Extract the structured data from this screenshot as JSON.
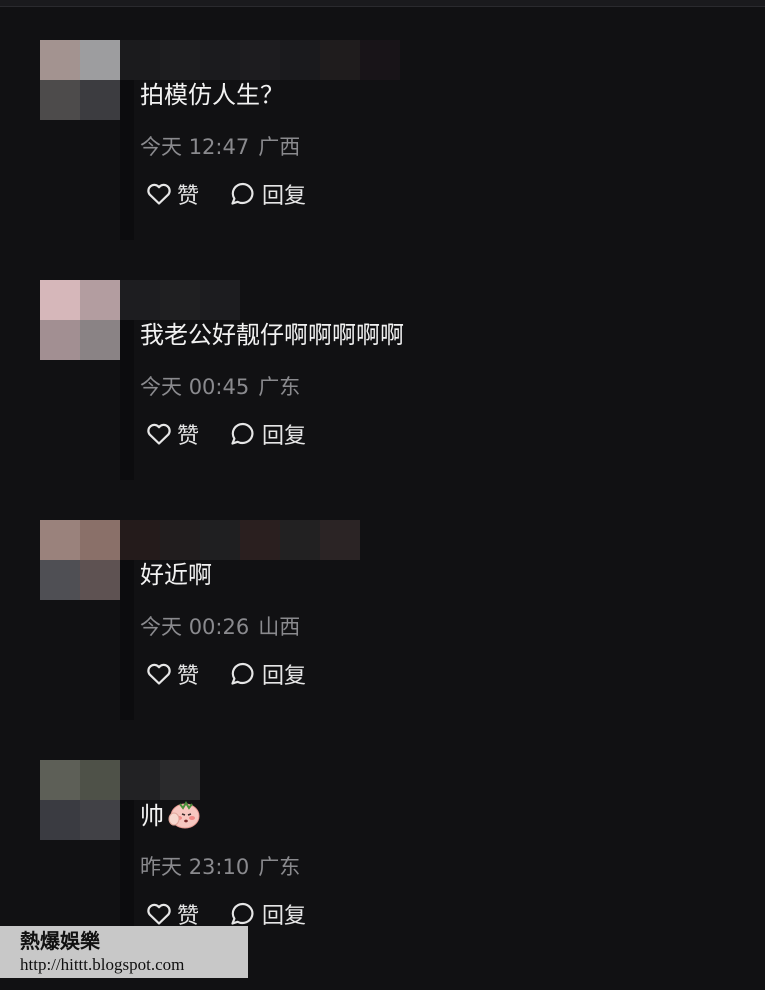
{
  "comments": [
    {
      "text": "拍模仿人生？",
      "date": "今天",
      "time": "12:47",
      "location": "广西",
      "like_label": "赞",
      "reply_label": "回复"
    },
    {
      "text": "我老公好靓仔啊啊啊啊啊",
      "date": "今天",
      "time": "00:45",
      "location": "广东",
      "like_label": "赞",
      "reply_label": "回复"
    },
    {
      "text": "好近啊",
      "date": "今天",
      "time": "00:26",
      "location": "山西",
      "like_label": "赞",
      "reply_label": "回复"
    },
    {
      "text": "帅",
      "date": "昨天",
      "time": "23:10",
      "location": "广东",
      "like_label": "赞",
      "reply_label": "回复"
    }
  ],
  "watermark": {
    "title": "熱爆娛樂",
    "url": "http://hittt.blogspot.com"
  },
  "icons": {
    "like": "heart-outline-icon",
    "reply": "speech-bubble-outline-icon",
    "emoji": "shy-face-emoji-icon"
  },
  "colors": {
    "background": "#111113",
    "text_primary": "#f2f2f2",
    "text_meta": "#8a8a8e",
    "watermark_bg": "#c8c8c8"
  }
}
